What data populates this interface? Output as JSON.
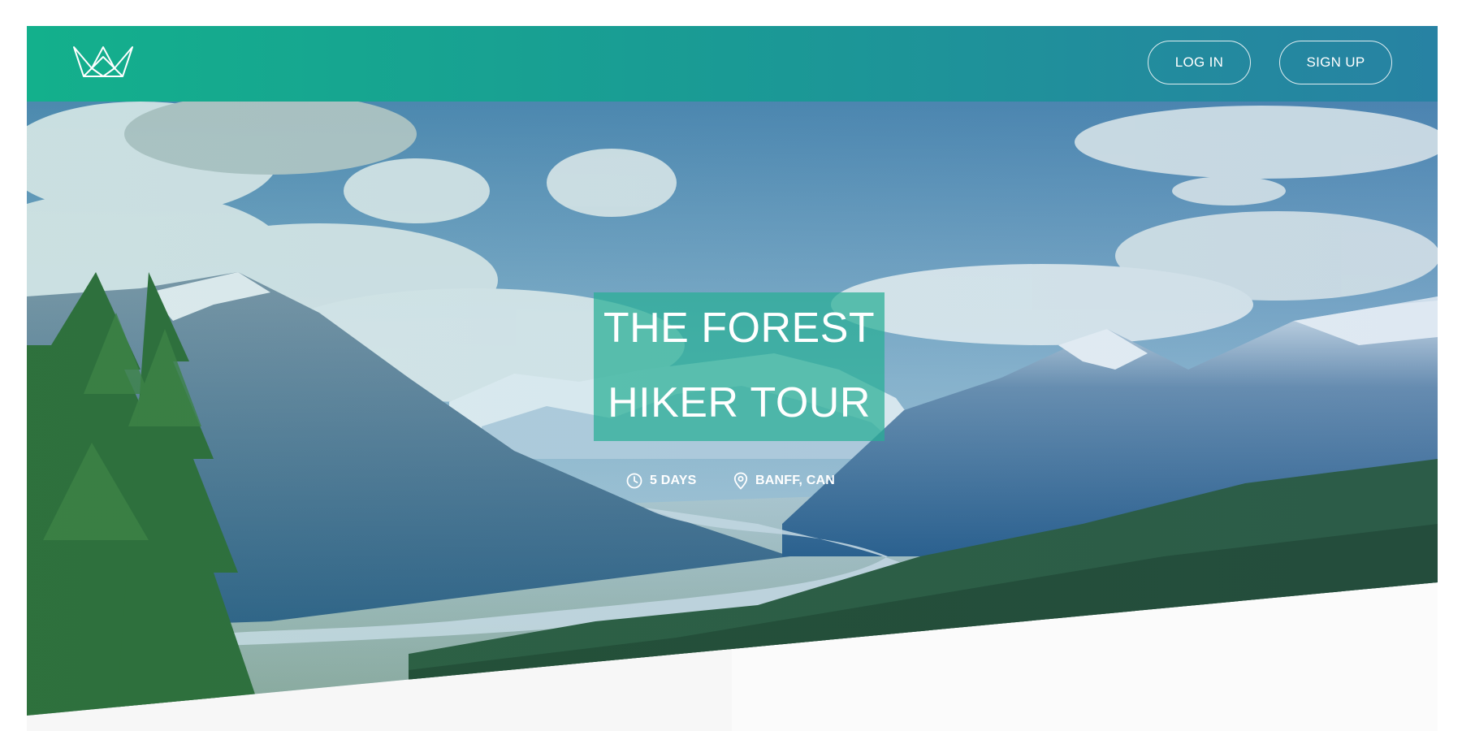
{
  "navbar": {
    "logo_icon": "crown-logo-icon",
    "login_label": "LOG IN",
    "signup_label": "SIGN UP",
    "gradient": [
      "#13b08c",
      "#2782a3"
    ]
  },
  "hero": {
    "title_line1": "THE FOREST",
    "title_line2": "HIKER TOUR",
    "duration_icon": "clock-icon",
    "duration": "5 DAYS",
    "location_icon": "map-pin-icon",
    "location": "BANFF, CAN",
    "accent_color": "#28af96"
  }
}
